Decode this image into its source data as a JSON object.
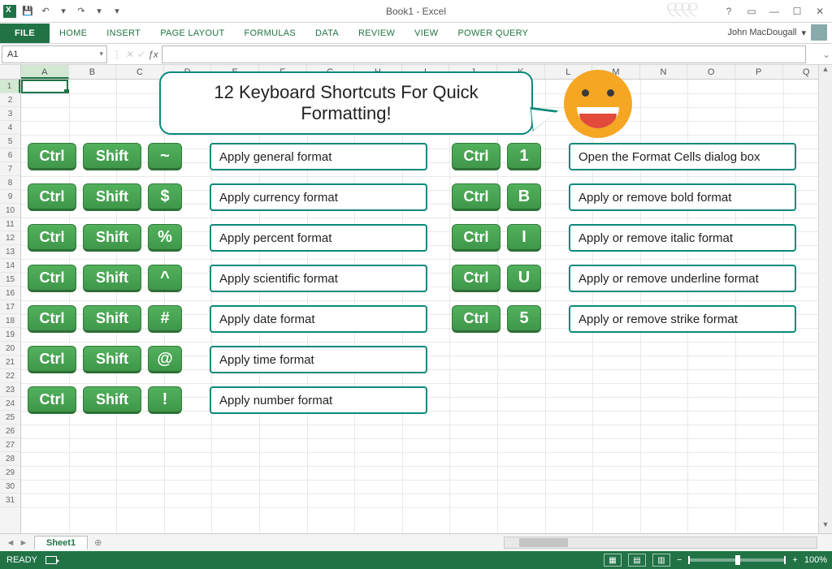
{
  "window": {
    "title": "Book1 - Excel"
  },
  "qat": {
    "save": "💾",
    "undo": "↶",
    "redo": "↷"
  },
  "ribbon": {
    "tabs": [
      "FILE",
      "HOME",
      "INSERT",
      "PAGE LAYOUT",
      "FORMULAS",
      "DATA",
      "REVIEW",
      "VIEW",
      "POWER QUERY"
    ]
  },
  "user": {
    "name": "John MacDougall"
  },
  "namebox": "A1",
  "columns": [
    "A",
    "B",
    "C",
    "D",
    "E",
    "F",
    "G",
    "H",
    "I",
    "J",
    "K",
    "L",
    "M",
    "N",
    "O",
    "P",
    "Q"
  ],
  "row_count": 31,
  "speech": "12 Keyboard Shortcuts For Quick Formatting!",
  "shortcuts_left": [
    {
      "k1": "Ctrl",
      "k2": "Shift",
      "k3": "~",
      "desc": "Apply general format"
    },
    {
      "k1": "Ctrl",
      "k2": "Shift",
      "k3": "$",
      "desc": "Apply currency format"
    },
    {
      "k1": "Ctrl",
      "k2": "Shift",
      "k3": "%",
      "desc": "Apply percent format"
    },
    {
      "k1": "Ctrl",
      "k2": "Shift",
      "k3": "^",
      "desc": "Apply scientific format"
    },
    {
      "k1": "Ctrl",
      "k2": "Shift",
      "k3": "#",
      "desc": "Apply date format"
    },
    {
      "k1": "Ctrl",
      "k2": "Shift",
      "k3": "@",
      "desc": "Apply time format"
    },
    {
      "k1": "Ctrl",
      "k2": "Shift",
      "k3": "!",
      "desc": "Apply number format"
    }
  ],
  "shortcuts_right": [
    {
      "k1": "Ctrl",
      "k3": "1",
      "desc": "Open the Format Cells dialog box"
    },
    {
      "k1": "Ctrl",
      "k3": "B",
      "desc": "Apply or remove bold format"
    },
    {
      "k1": "Ctrl",
      "k3": "I",
      "desc": "Apply or remove italic format"
    },
    {
      "k1": "Ctrl",
      "k3": "U",
      "desc": "Apply or remove underline format"
    },
    {
      "k1": "Ctrl",
      "k3": "5",
      "desc": "Apply or remove strike format"
    }
  ],
  "sheet": {
    "active": "Sheet1"
  },
  "status": {
    "state": "READY",
    "zoom": "100%"
  }
}
